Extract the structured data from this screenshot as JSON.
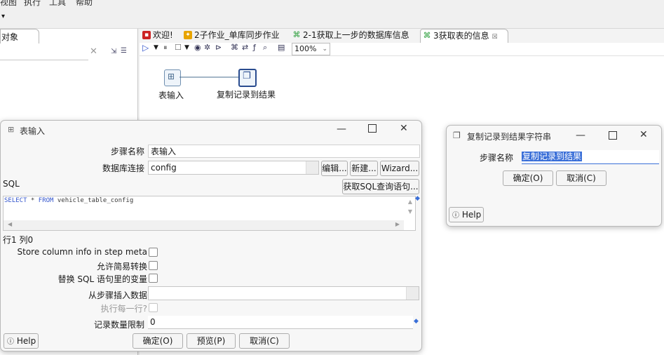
{
  "menu": {
    "items": [
      "视图",
      "执行",
      "工具",
      "帮助"
    ]
  },
  "left_panel": {
    "tab_label": "对象"
  },
  "editor": {
    "tabs": [
      {
        "label": "欢迎!",
        "icon": "welcome-icon",
        "color": "#cc2222"
      },
      {
        "label": "2子作业_单库同步作业",
        "icon": "job-icon",
        "color": "#e8a400"
      },
      {
        "label": "2-1获取上一步的数据库信息",
        "icon": "transformation-icon",
        "color": "#2a9d3a"
      },
      {
        "label": "3获取表的信息",
        "icon": "transformation-icon",
        "color": "#2a9d3a",
        "active": true,
        "close": "☒"
      }
    ],
    "zoom": "100%"
  },
  "canvas": {
    "steps": [
      {
        "label": "表输入",
        "icon": "table-input-icon"
      },
      {
        "label": "复制记录到结果",
        "icon": "copy-rows-icon"
      }
    ]
  },
  "table_input_dialog": {
    "title": "表输入",
    "step_name_label": "步骤名称",
    "step_name_value": "表输入",
    "db_connection_label": "数据库连接",
    "db_connection_value": "config",
    "edit_button": "编辑...",
    "new_button": "新建...",
    "wizard_button": "Wizard...",
    "sql_label": "SQL",
    "get_sql_button": "获取SQL查询语句...",
    "sql": {
      "kw1": "SELECT",
      "star": " * ",
      "kw2": "FROM",
      "rest": " vehicle_table_config"
    },
    "cursor_pos": "行1 列0",
    "store_column_info_label": "Store column info in step meta",
    "lazy_conversion_label": "允许简易转换",
    "replace_vars_label": "替换 SQL 语句里的变量",
    "insert_from_step_label": "从步骤插入数据",
    "execute_each_row_label": "执行每一行?",
    "limit_label": "记录数量限制",
    "limit_value": "0",
    "help_button": "Help",
    "ok_button": "确定(O)",
    "preview_button": "预览(P)",
    "cancel_button": "取消(C)"
  },
  "copy_rows_dialog": {
    "title": "复制记录到结果字符串",
    "step_name_label": "步骤名称",
    "step_name_value": "复制记录到结果",
    "ok_button": "确定(O)",
    "cancel_button": "取消(C)",
    "help_button": "Help"
  },
  "colors": {
    "accent": "#3a6fd8",
    "selection": "#3a6fd8"
  }
}
